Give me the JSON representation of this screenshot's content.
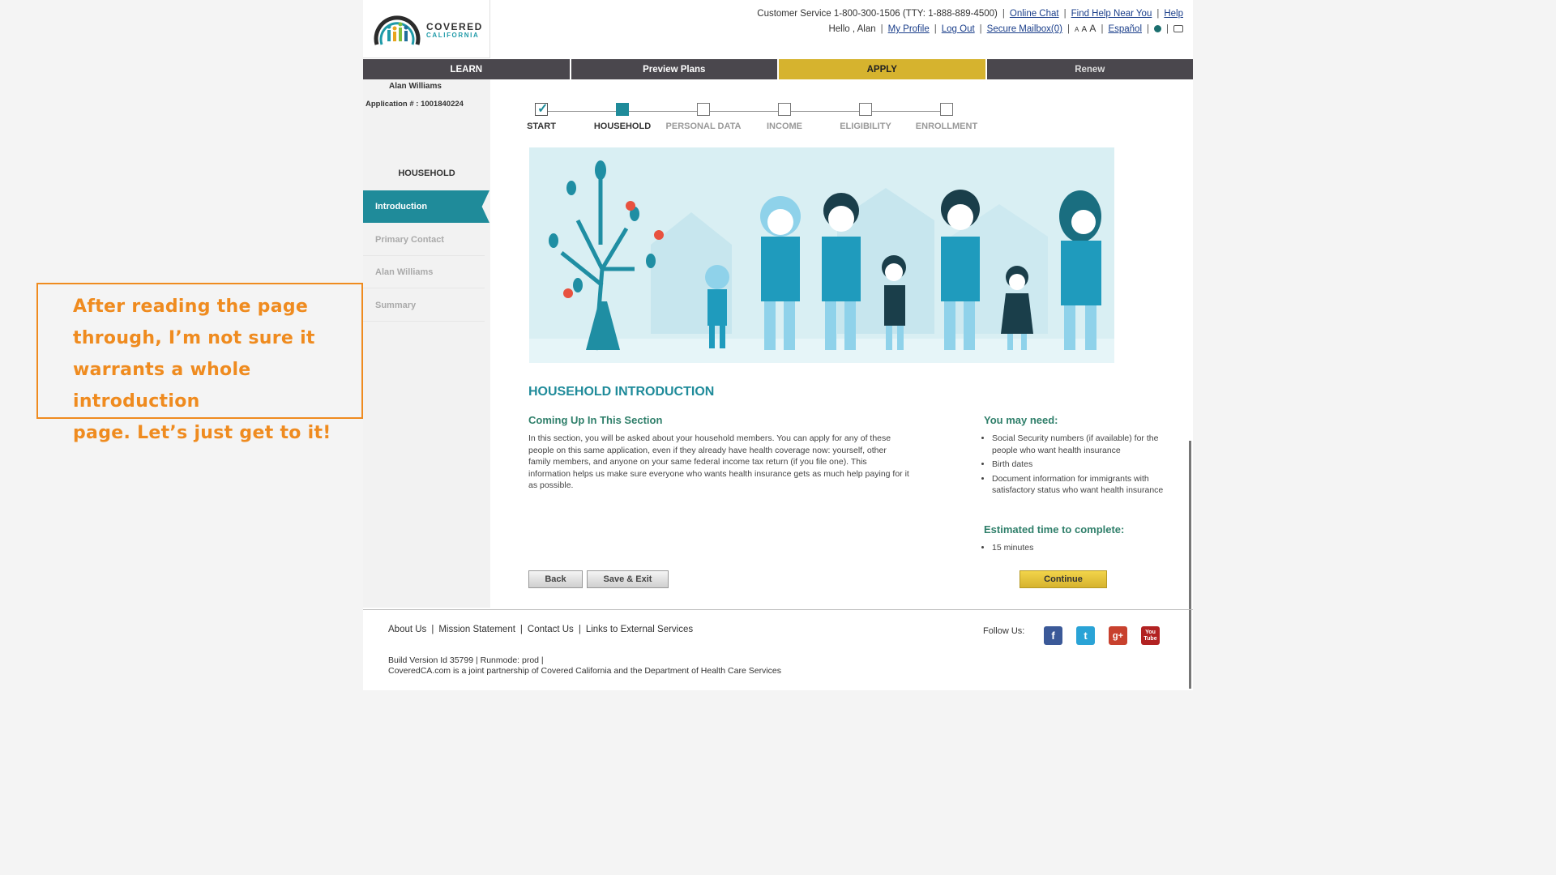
{
  "header": {
    "logo_top": "COVERED",
    "logo_bottom": "CALIFORNIA",
    "customer_service": "Customer Service 1-800-300-1506 (TTY: 1-888-889-4500)",
    "online_chat": "Online Chat",
    "find_help": "Find Help Near You",
    "help": "Help",
    "hello": "Hello , Alan",
    "my_profile": "My Profile",
    "log_out": "Log Out",
    "secure_mailbox": "Secure Mailbox(0)",
    "font_a1": "A",
    "font_a2": "A",
    "font_a3": "A",
    "language": "Español"
  },
  "nav": {
    "items": [
      {
        "label": "LEARN"
      },
      {
        "label": "Preview Plans"
      },
      {
        "label": "APPLY",
        "active": true
      },
      {
        "label": "Renew"
      }
    ]
  },
  "sidebar": {
    "applicant_name": "Alan Williams",
    "application_number": "Application # : 1001840224",
    "section_title": "HOUSEHOLD",
    "items": [
      {
        "label": "Introduction",
        "active": true
      },
      {
        "label": "Primary Contact"
      },
      {
        "label": "Alan Williams"
      },
      {
        "label": "Summary"
      }
    ]
  },
  "progress": {
    "steps": [
      {
        "label": "START",
        "state": "done"
      },
      {
        "label": "HOUSEHOLD",
        "state": "current"
      },
      {
        "label": "PERSONAL DATA",
        "state": "todo"
      },
      {
        "label": "INCOME",
        "state": "todo"
      },
      {
        "label": "ELIGIBILITY",
        "state": "todo"
      },
      {
        "label": "ENROLLMENT",
        "state": "todo"
      }
    ]
  },
  "main": {
    "title": "HOUSEHOLD INTRODUCTION",
    "coming_up_heading": "Coming Up In This Section",
    "coming_up_text": "In this section, you will be asked about your household members. You can apply for any of these people on this same application, even if they already have health coverage now: yourself, other family members, and anyone on your same federal income tax return (if you file one). This information helps us make sure everyone who wants health insurance gets as much help paying for it as possible.",
    "you_may_need_heading": "You may need:",
    "you_may_need": [
      "Social Security numbers (if available) for the people who want health insurance",
      "Birth dates",
      "Document information for immigrants with satisfactory status who want health insurance"
    ],
    "estimated_heading": "Estimated time to complete:",
    "estimated_time": "15 minutes",
    "back": "Back",
    "save_exit": "Save & Exit",
    "continue": "Continue"
  },
  "footer": {
    "links": [
      "About Us",
      "Mission Statement",
      "Contact Us",
      "Links to External Services"
    ],
    "build": "Build Version Id 35799  |    Runmode: prod  |",
    "partner": "CoveredCA.com is a joint partnership of Covered California and the Department of Health Care Services",
    "follow": "Follow Us:",
    "social": [
      "f",
      "t",
      "g+",
      "You Tube"
    ]
  },
  "annotation": {
    "lines": [
      "After reading the page",
      "through, I’m not sure it",
      "warrants a whole introduction",
      "page. Let’s just get to it!"
    ]
  },
  "colors": {
    "teal": "#1f8b9a",
    "nav_dark": "#4a474d",
    "apply_gold": "#d6b32e",
    "annotation_orange": "#ef8b1f"
  }
}
